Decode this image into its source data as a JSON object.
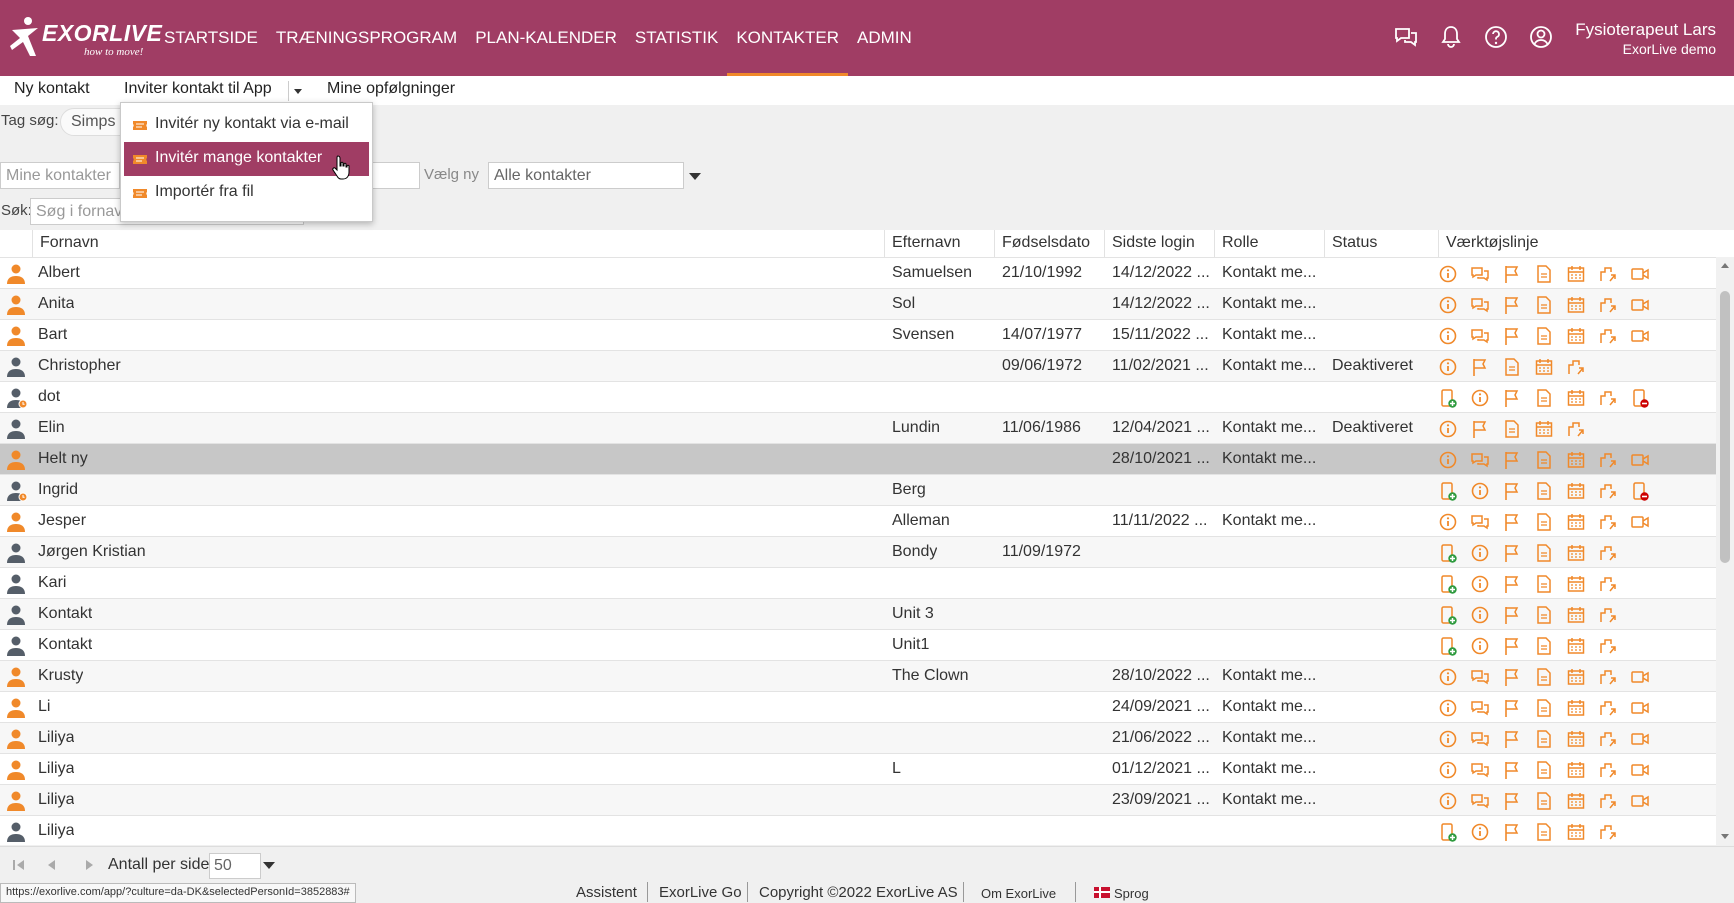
{
  "app": {
    "logo_text": "EXORLIVE",
    "logo_tagline": "how to move!",
    "brand_color": "#a03d64",
    "accent_color": "#f0892a"
  },
  "nav": [
    {
      "label": "STARTSIDE",
      "active": false
    },
    {
      "label": "TRÆNINGSPROGRAM",
      "active": false
    },
    {
      "label": "PLAN-KALENDER",
      "active": false
    },
    {
      "label": "STATISTIK",
      "active": false
    },
    {
      "label": "KONTAKTER",
      "active": true
    },
    {
      "label": "ADMIN",
      "active": false
    }
  ],
  "top_icons": [
    "chat-icon",
    "bell-icon",
    "help-icon",
    "user-circle-icon"
  ],
  "user": {
    "name": "Fysioterapeut Lars",
    "org": "ExorLive demo"
  },
  "subnav": {
    "new_contact": "Ny kontakt",
    "invite": "Inviter kontakt til App",
    "followups": "Mine opfølgninger"
  },
  "dropdown": {
    "items": [
      {
        "label": "Invitér ny kontakt via e-mail",
        "highlighted": false
      },
      {
        "label": "Invitér mange kontakter",
        "highlighted": true
      },
      {
        "label": "Importér fra fil",
        "highlighted": false
      }
    ]
  },
  "filters": {
    "tag_label": "Tag søg:",
    "tag_value": "Simps",
    "my_contacts_placeholder": "Mine kontakter",
    "choose_label": "Vælg ny",
    "choose_value": "Alle kontakter",
    "search_label": "Søk:",
    "search_placeholder": "Søg i fornavn"
  },
  "table": {
    "columns": [
      "Fornavn",
      "Efternavn",
      "Fødselsdato",
      "Sidste login",
      "Rolle",
      "Status",
      "Værktøjslinje"
    ],
    "rows": [
      {
        "first": "Albert",
        "last": "Samuelsen",
        "birth": "21/10/1992",
        "login": "14/12/2022 ...",
        "role": "Kontakt me...",
        "status": "",
        "person": "orange",
        "tools": "full"
      },
      {
        "first": "Anita",
        "last": "Sol",
        "birth": "",
        "login": "14/12/2022 ...",
        "role": "Kontakt me...",
        "status": "",
        "person": "orange",
        "tools": "full"
      },
      {
        "first": "Bart",
        "last": "Svensen",
        "birth": "14/07/1977",
        "login": "15/11/2022 ...",
        "role": "Kontakt me...",
        "status": "",
        "person": "orange",
        "tools": "full"
      },
      {
        "first": "Christopher",
        "last": "",
        "birth": "09/06/1972",
        "login": "11/02/2021 ...",
        "role": "Kontakt me...",
        "status": "Deaktiveret",
        "person": "gray",
        "tools": "deact"
      },
      {
        "first": "dot",
        "last": "",
        "birth": "",
        "login": "",
        "role": "",
        "status": "",
        "person": "pending",
        "tools": "pending"
      },
      {
        "first": "Elin",
        "last": "Lundin",
        "birth": "11/06/1986",
        "login": "12/04/2021 ...",
        "role": "Kontakt me...",
        "status": "Deaktiveret",
        "person": "gray",
        "tools": "deact"
      },
      {
        "first": "Helt ny",
        "last": "",
        "birth": "",
        "login": "28/10/2021 ...",
        "role": "Kontakt me...",
        "status": "",
        "person": "orange",
        "tools": "full",
        "selected": true
      },
      {
        "first": "Ingrid",
        "last": "Berg",
        "birth": "",
        "login": "",
        "role": "",
        "status": "",
        "person": "pending",
        "tools": "pending"
      },
      {
        "first": "Jesper",
        "last": "Alleman",
        "birth": "",
        "login": "11/11/2022 ...",
        "role": "Kontakt me...",
        "status": "",
        "person": "orange",
        "tools": "full"
      },
      {
        "first": "Jørgen Kristian",
        "last": "Bondy",
        "birth": "11/09/1972",
        "login": "",
        "role": "",
        "status": "",
        "person": "gray",
        "tools": "invite"
      },
      {
        "first": "Kari",
        "last": "",
        "birth": "",
        "login": "",
        "role": "",
        "status": "",
        "person": "gray",
        "tools": "invite"
      },
      {
        "first": "Kontakt",
        "last": "Unit 3",
        "birth": "",
        "login": "",
        "role": "",
        "status": "",
        "person": "gray",
        "tools": "invite"
      },
      {
        "first": "Kontakt",
        "last": "Unit1",
        "birth": "",
        "login": "",
        "role": "",
        "status": "",
        "person": "gray",
        "tools": "invite"
      },
      {
        "first": "Krusty",
        "last": "The Clown",
        "birth": "",
        "login": "28/10/2022 ...",
        "role": "Kontakt me...",
        "status": "",
        "person": "orange",
        "tools": "full"
      },
      {
        "first": "Li",
        "last": "",
        "birth": "",
        "login": "24/09/2021 ...",
        "role": "Kontakt me...",
        "status": "",
        "person": "orange",
        "tools": "full"
      },
      {
        "first": "Liliya",
        "last": "",
        "birth": "",
        "login": "21/06/2022 ...",
        "role": "Kontakt me...",
        "status": "",
        "person": "orange",
        "tools": "full"
      },
      {
        "first": "Liliya",
        "last": "L",
        "birth": "",
        "login": "01/12/2021 ...",
        "role": "Kontakt me...",
        "status": "",
        "person": "orange",
        "tools": "full"
      },
      {
        "first": "Liliya",
        "last": "",
        "birth": "",
        "login": "23/09/2021 ...",
        "role": "Kontakt me...",
        "status": "",
        "person": "orange",
        "tools": "full"
      },
      {
        "first": "Liliya",
        "last": "",
        "birth": "",
        "login": "",
        "role": "",
        "status": "",
        "person": "gray",
        "tools": "invite"
      }
    ]
  },
  "pager": {
    "per_page_label": "Antall per side",
    "per_page_value": "50"
  },
  "footer": {
    "status_url": "https://exorlive.com/app/?culture=da-DK&selectedPersonId=3852883#",
    "assistant": "Assistent",
    "go": "ExorLive Go",
    "copyright": "Copyright ©2022 ExorLive AS",
    "about": "Om ExorLive",
    "language": "Sprog"
  }
}
